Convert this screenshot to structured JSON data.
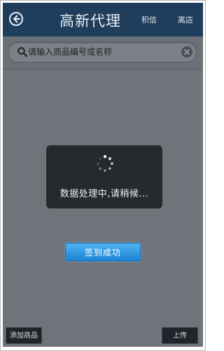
{
  "header": {
    "title": "高新代理",
    "link_one": "积信",
    "link_two": "离店",
    "back_icon": "back-arrow-icon"
  },
  "search": {
    "placeholder": "请输入商品编号或名称",
    "value": ""
  },
  "loading": {
    "message": "数据处理中,请稍候..."
  },
  "toast": {
    "label": "签到成功"
  },
  "bottom": {
    "left_label": "添加商品",
    "right_label": "上传"
  },
  "colors": {
    "header_bg": "#1f3d5c",
    "overlay_bg": "#6f747b",
    "dialog_bg": "#26292d",
    "accent": "#1d84d4"
  }
}
